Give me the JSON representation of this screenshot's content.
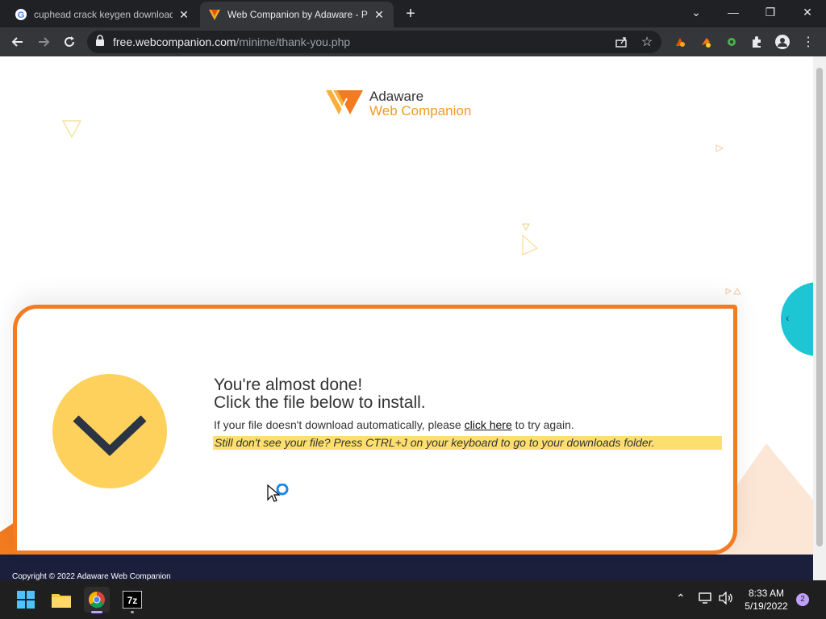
{
  "browser": {
    "tabs": [
      {
        "title": "cuphead crack keygen download"
      },
      {
        "title": "Web Companion by Adaware - P"
      }
    ],
    "url_host": "free.webcompanion.com",
    "url_path": "/minime/thank-you.php"
  },
  "page": {
    "logo_line1": "Adaware",
    "logo_line2": "Web Companion",
    "heading_line1": "You're almost done!",
    "heading_line2": "Click the file below to install.",
    "sub_prefix": "If your file doesn't download automatically, please ",
    "sub_link": "click here",
    "sub_suffix": " to try again.",
    "hint": "Still don't see your file? Press CTRL+J on your keyboard to go to your downloads folder.",
    "footer": "Copyright © 2022 Adaware Web Companion"
  },
  "taskbar": {
    "time": "8:33 AM",
    "date": "5/19/2022",
    "notification_count": "2"
  },
  "colors": {
    "brand_orange": "#f47b20",
    "brand_yellow": "#fdd15c",
    "teal": "#1ec6d3"
  }
}
